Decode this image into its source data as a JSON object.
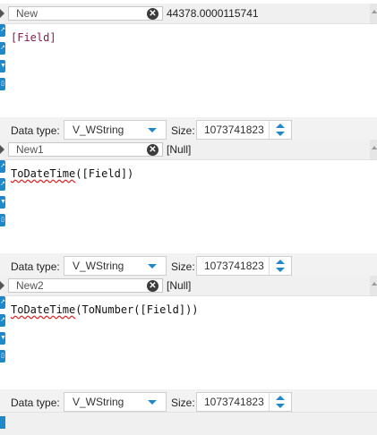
{
  "labels": {
    "data_type": "Data type:",
    "size": "Size:"
  },
  "icons": {
    "clear": "close-circle-icon",
    "expand": "chevron-right-icon",
    "dropdown": "caret-down-icon",
    "spin_up": "spin-up-icon",
    "spin_down": "spin-down-icon"
  },
  "colors": {
    "accent": "#1e88c8",
    "field_text": "#8b1a4a",
    "error_underline": "#d22"
  },
  "fields": [
    {
      "name": "New",
      "preview": "44378.0000115741",
      "expression": "[Field]",
      "data_type": "V_WString",
      "size": "1073741823"
    },
    {
      "name": "New1",
      "preview": "[Null]",
      "expr_fn": "ToDateTime",
      "expr_rest": "([Field])",
      "data_type": "V_WString",
      "size": "1073741823"
    },
    {
      "name": "New2",
      "preview": "[Null]",
      "expr_fn": "ToDateTime",
      "expr_rest": "(ToNumber([Field]))",
      "data_type": "V_WString",
      "size": "1073741823"
    }
  ]
}
